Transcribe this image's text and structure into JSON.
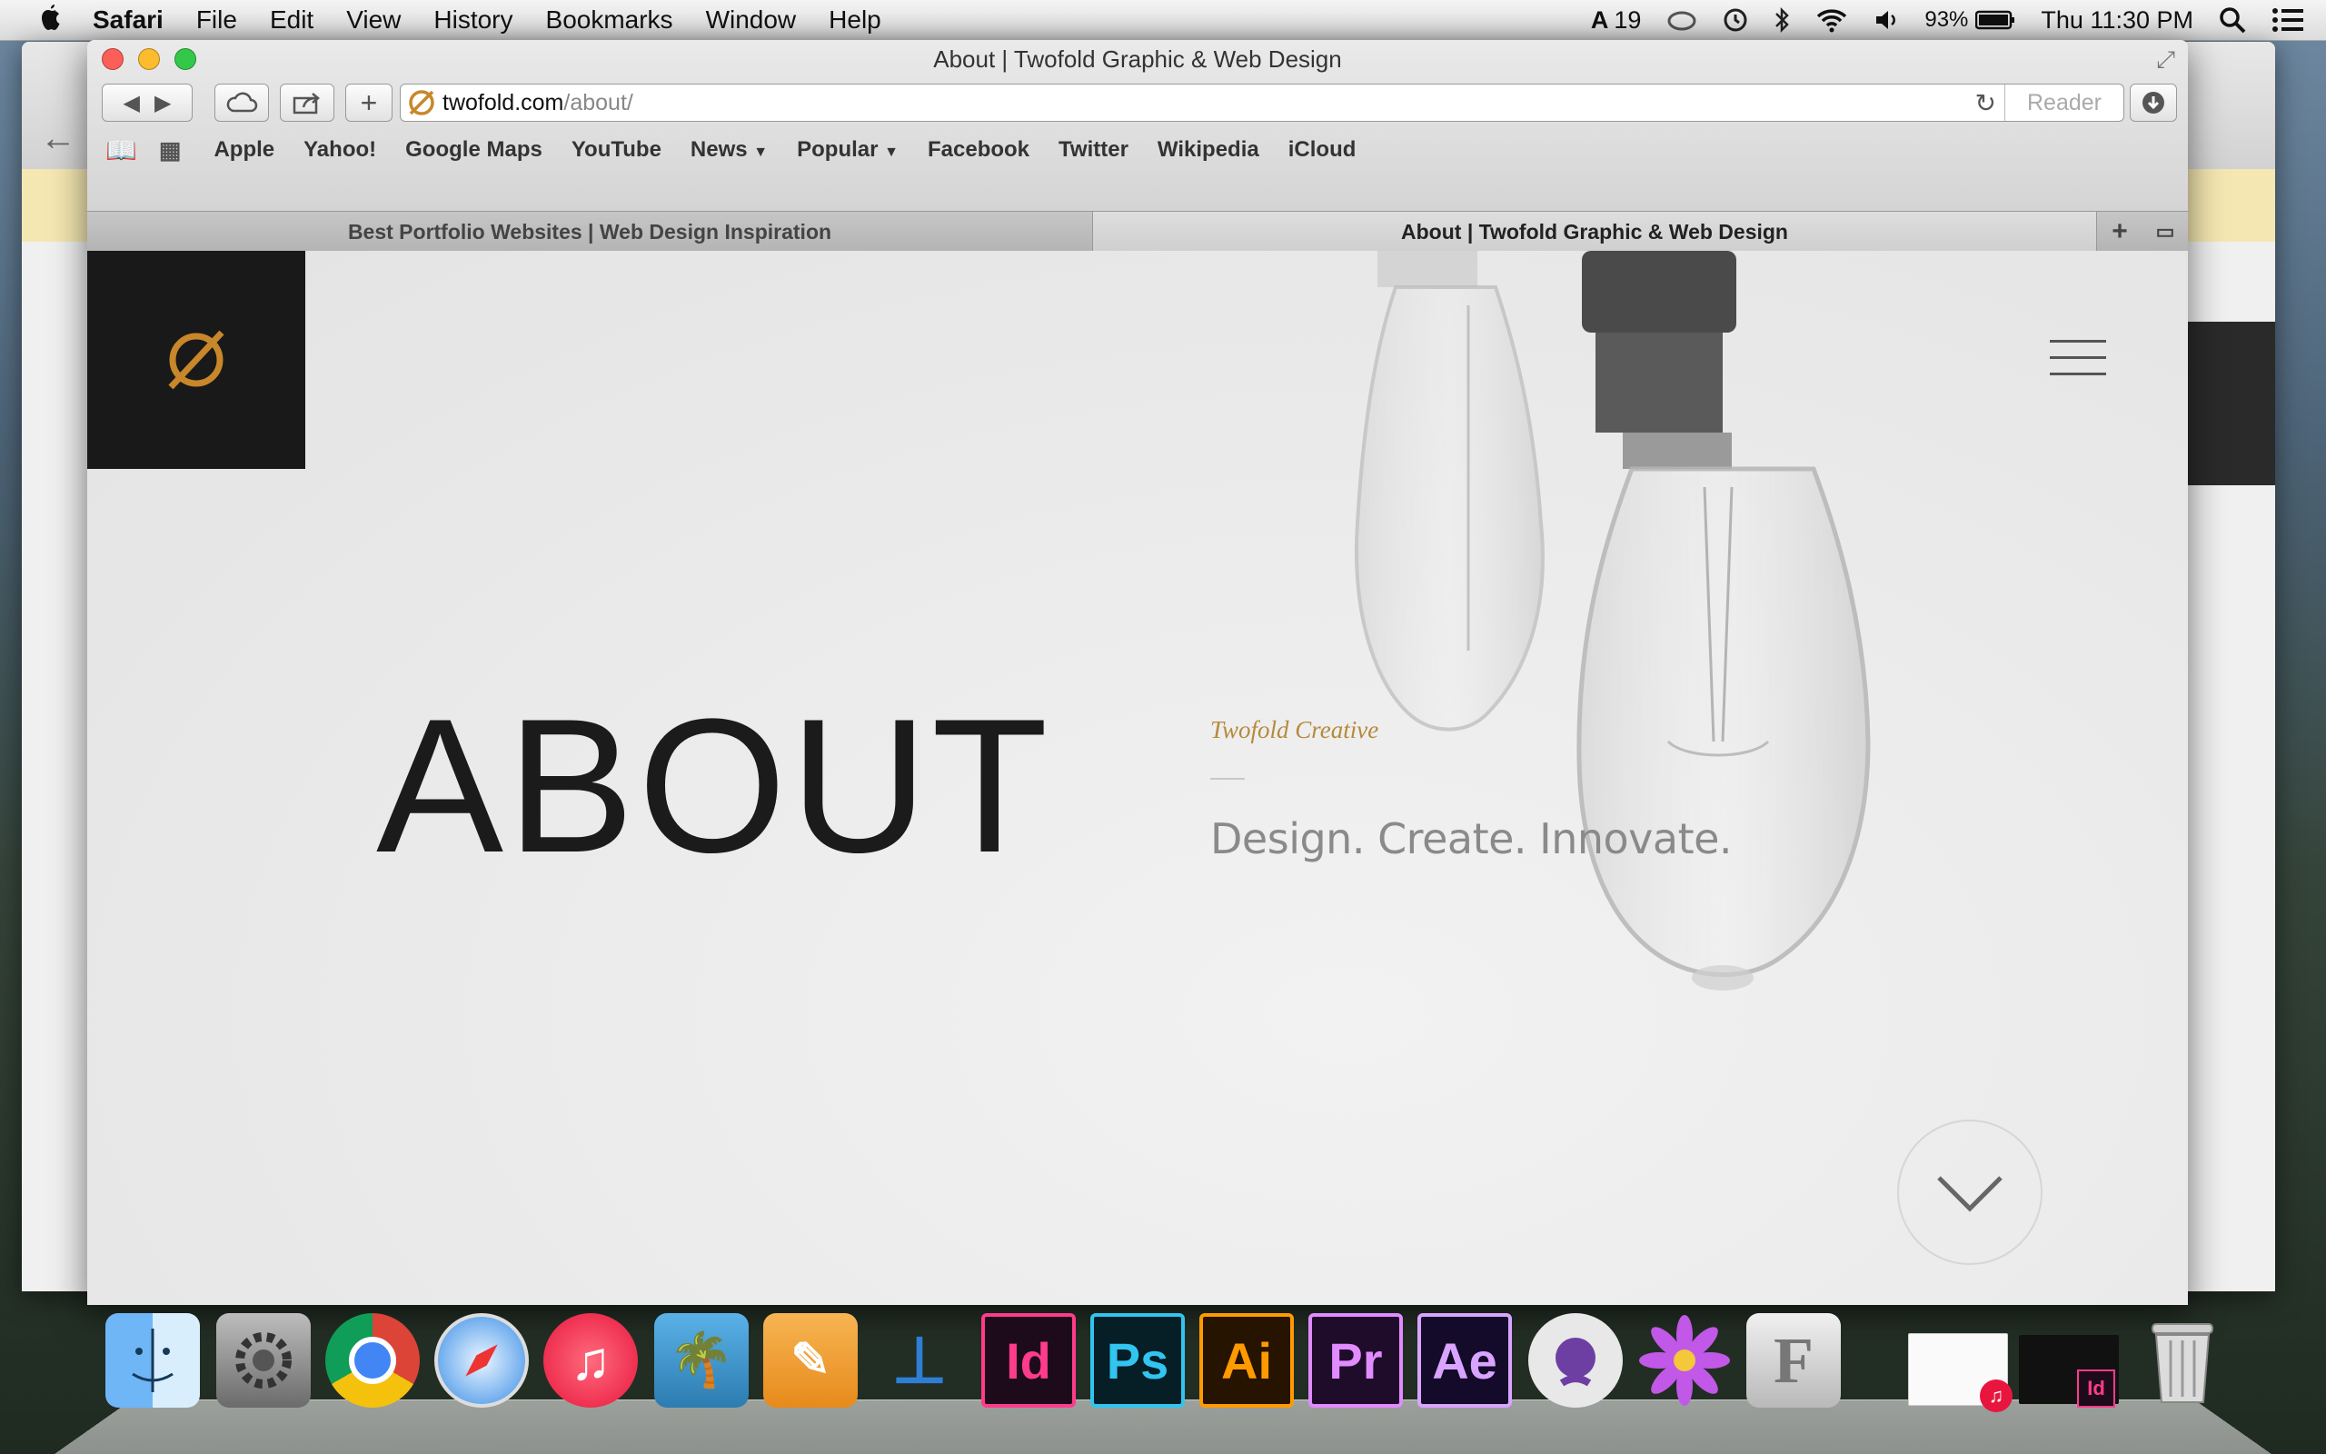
{
  "menubar": {
    "apple_icon": "apple-logo",
    "app_name": "Safari",
    "items": [
      "File",
      "Edit",
      "View",
      "History",
      "Bookmarks",
      "Window",
      "Help"
    ],
    "status": {
      "adobe_count": "19",
      "battery": "93%",
      "clock": "Thu 11:30 PM"
    }
  },
  "window": {
    "title": "About | Twofold Graphic & Web Design",
    "address": {
      "domain": "twofold.com",
      "path": "/about/",
      "reader_label": "Reader"
    },
    "bookmarks": [
      "Apple",
      "Yahoo!",
      "Google Maps",
      "YouTube",
      "News",
      "Popular",
      "Facebook",
      "Twitter",
      "Wikipedia",
      "iCloud"
    ],
    "tabs": [
      {
        "label": "Best Portfolio Websites | Web Design Inspiration",
        "active": false
      },
      {
        "label": "About | Twofold Graphic & Web Design",
        "active": true
      }
    ]
  },
  "page": {
    "heading": "ABOUT",
    "subtitle": "Twofold Creative",
    "tagline": "Design. Create. Innovate.",
    "accent_color": "#b58a3c"
  },
  "dock": {
    "apps": [
      {
        "name": "Finder",
        "icon": "finder-icon"
      },
      {
        "name": "System Preferences",
        "icon": "gear-icon"
      },
      {
        "name": "Chrome",
        "icon": "chrome-icon"
      },
      {
        "name": "Safari",
        "icon": "safari-icon"
      },
      {
        "name": "iTunes",
        "icon": "music-icon"
      },
      {
        "name": "iPhoto",
        "icon": "photo-icon"
      },
      {
        "name": "Pages",
        "icon": "pages-icon"
      },
      {
        "name": "Keynote",
        "icon": "keynote-icon"
      },
      {
        "name": "InDesign",
        "label": "Id",
        "icon": "indesign-icon",
        "color": "#ff3b8b"
      },
      {
        "name": "Photoshop",
        "label": "Ps",
        "icon": "photoshop-icon",
        "color": "#31c5f0"
      },
      {
        "name": "Illustrator",
        "label": "Ai",
        "icon": "illustrator-icon",
        "color": "#ff9a00"
      },
      {
        "name": "Premiere",
        "label": "Pr",
        "icon": "premiere-icon",
        "color": "#e08bff"
      },
      {
        "name": "After Effects",
        "label": "Ae",
        "icon": "aftereffects-icon",
        "color": "#d8a4ff"
      },
      {
        "name": "GitHub",
        "icon": "github-icon"
      },
      {
        "name": "Flower",
        "icon": "flower-icon"
      },
      {
        "name": "Font Book",
        "icon": "fontbook-icon"
      }
    ]
  }
}
